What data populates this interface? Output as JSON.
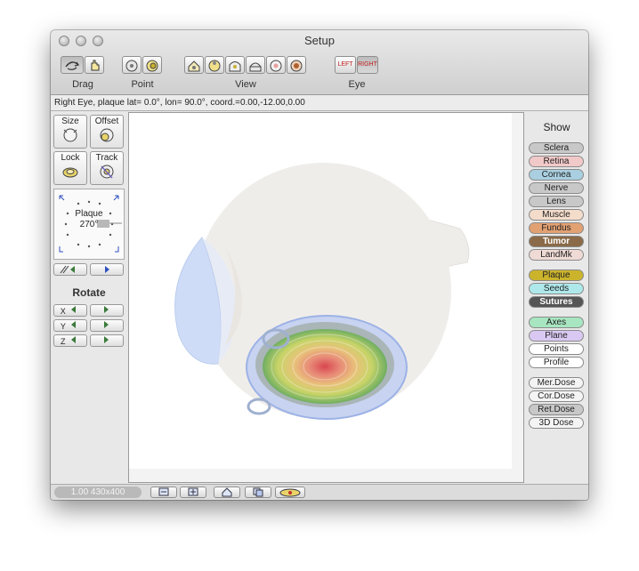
{
  "window": {
    "title": "Setup"
  },
  "toolbar": {
    "groups": [
      {
        "label": "Drag"
      },
      {
        "label": "Point"
      },
      {
        "label": "View"
      },
      {
        "label": "Eye"
      }
    ],
    "eye_left": "LEFT",
    "eye_right": "RIGHT"
  },
  "status": {
    "text": "Right Eye, plaque lat=  0.0°, lon= 90.0°, coord.=0.00,-12.00,0.00"
  },
  "left_panel": {
    "size": "Size",
    "offset": "Offset",
    "lock": "Lock",
    "track": "Track",
    "plaque_label": "Plaque",
    "plaque_angle": "270°",
    "rotate": "Rotate",
    "axes": [
      "X",
      "Y",
      "Z"
    ]
  },
  "show": {
    "title": "Show",
    "items": [
      {
        "label": "Sclera",
        "color": "#c8c8c8"
      },
      {
        "label": "Retina",
        "color": "#f2c9c9"
      },
      {
        "label": "Cornea",
        "color": "#a9cfe0"
      },
      {
        "label": "Nerve",
        "color": "#c8c8c8"
      },
      {
        "label": "Lens",
        "color": "#c8c8c8"
      },
      {
        "label": "Muscle",
        "color": "#f4dccb"
      },
      {
        "label": "Fundus",
        "color": "#e2a173"
      },
      {
        "label": "Tumor",
        "color": "#8a6a48"
      },
      {
        "label": "LandMk",
        "color": "#efdad5"
      },
      {
        "label": "Plaque",
        "color": "#cbb42c"
      },
      {
        "label": "Seeds",
        "color": "#aee8ea"
      },
      {
        "label": "Sutures",
        "color": "#555555"
      },
      {
        "label": "Axes",
        "color": "#a7e6c0"
      },
      {
        "label": "Plane",
        "color": "#d9c9f2"
      },
      {
        "label": "Points",
        "color": "#ffffff"
      },
      {
        "label": "Profile",
        "color": "#ffffff"
      },
      {
        "label": "Mer.Dose",
        "color": "#f4f4f4"
      },
      {
        "label": "Cor.Dose",
        "color": "#f4f4f4"
      },
      {
        "label": "Ret.Dose",
        "color": "#c8c8c8"
      },
      {
        "label": "3D Dose",
        "color": "#f4f4f4"
      }
    ]
  },
  "bottom": {
    "zoom": "1.00 430x400"
  }
}
